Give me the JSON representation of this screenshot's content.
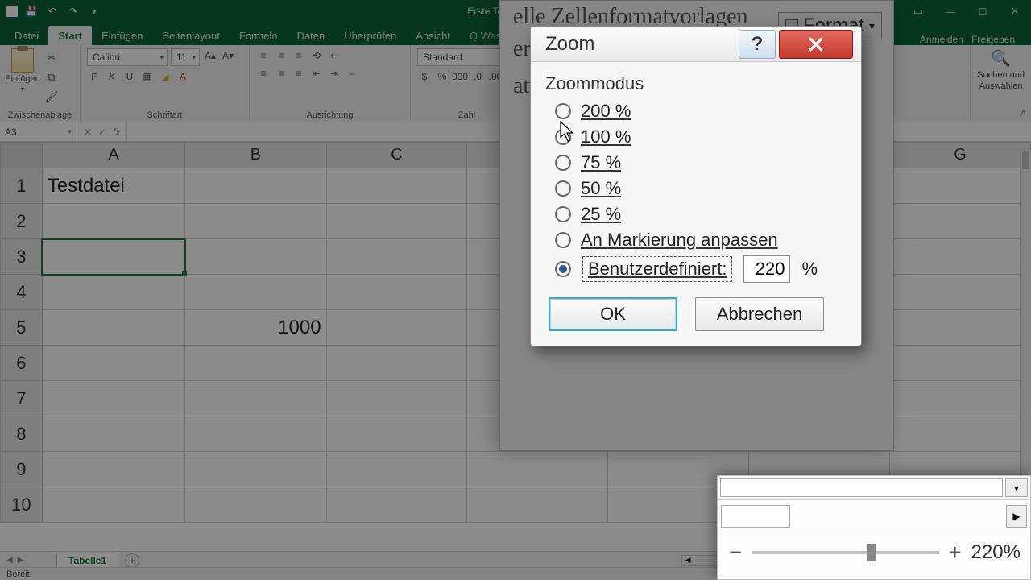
{
  "titlebar": {
    "doc_title": "Erste Testdatei - Excel"
  },
  "tabs": {
    "datei": "Datei",
    "start": "Start",
    "einfugen": "Einfügen",
    "seitenlayout": "Seitenlayout",
    "formeln": "Formeln",
    "daten": "Daten",
    "uberprufen": "Überprüfen",
    "ansicht": "Ansicht",
    "was": "Q Was möchten Sie tun?",
    "anmelden": "Anmelden",
    "freigeben": "Freigeben"
  },
  "ribbon": {
    "paste": "Einfügen",
    "clipboard_label": "Zwischenablage",
    "font_name": "Calibri",
    "font_size": "11",
    "font_label": "Schriftart",
    "align_label": "Ausrichtung",
    "number_format": "Standard",
    "number_label": "Zahl",
    "find_line1": "Suchen und",
    "find_line2": "Auswählen"
  },
  "fx": {
    "namebox": "A3",
    "fx_symbol": "fx"
  },
  "grid": {
    "cols": [
      "A",
      "B",
      "C",
      "",
      "",
      "",
      "G"
    ],
    "rows": [
      "1",
      "2",
      "3",
      "4",
      "5",
      "6",
      "7",
      "8",
      "9",
      "10"
    ],
    "a1": "Testdatei",
    "b5": "1000"
  },
  "sheets": {
    "tab1": "Tabelle1"
  },
  "status": {
    "ready": "Bereit"
  },
  "bgfrag": {
    "line1": "elle   Zellenformatvorlagen",
    "line2": "eren",
    "line3": "atvorlagen",
    "format": "Format"
  },
  "zoom_dialog": {
    "title": "Zoom",
    "mode_label": "Zoommodus",
    "opt200": "200 %",
    "opt100": "100 %",
    "opt75": "75 %",
    "opt50": "50 %",
    "opt25": "25 %",
    "fit": "An Markierung anpassen",
    "custom_label": "Benutzerdefiniert:",
    "custom_value": "220",
    "percent": "%",
    "ok": "OK",
    "cancel": "Abbrechen",
    "help_char": "?"
  },
  "zoom_popup": {
    "minus": "−",
    "plus": "+",
    "pct": "220%"
  }
}
